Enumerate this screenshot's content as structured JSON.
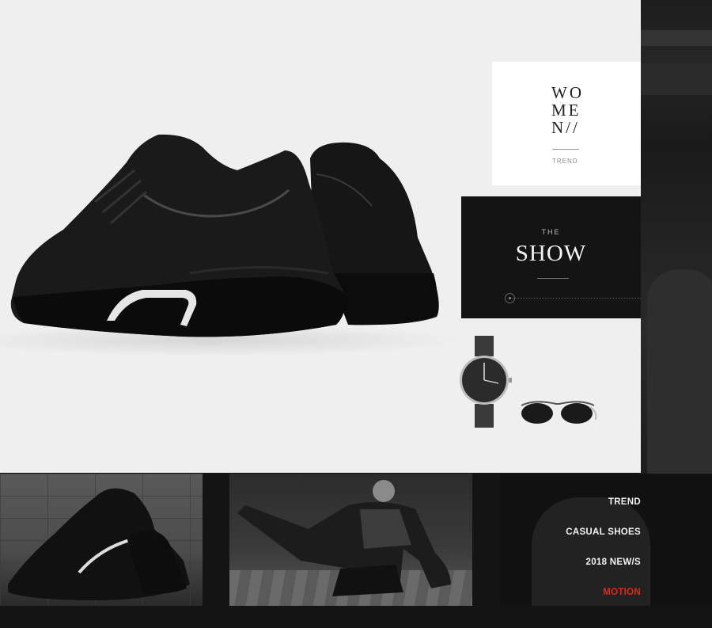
{
  "women_card": {
    "lines": [
      "WO",
      "ME",
      "N//"
    ],
    "sub": "TREND"
  },
  "show_card": {
    "eyebrow": "THE",
    "title": "SHOW"
  },
  "nav": {
    "items": [
      {
        "label": "TREND",
        "active": false
      },
      {
        "label": "CASUAL SHOES",
        "active": false
      },
      {
        "label": "2018 NEW/S",
        "active": false
      },
      {
        "label": "MOTION",
        "active": true
      }
    ],
    "active_color": "#e0281c"
  },
  "images": {
    "hero": "black-mesh-sneakers-pair",
    "accessories": [
      "watch-icon",
      "sunglasses-icon"
    ],
    "thumbs": [
      "sneaker-on-brick",
      "man-crouching",
      "man-in-jacket"
    ]
  }
}
